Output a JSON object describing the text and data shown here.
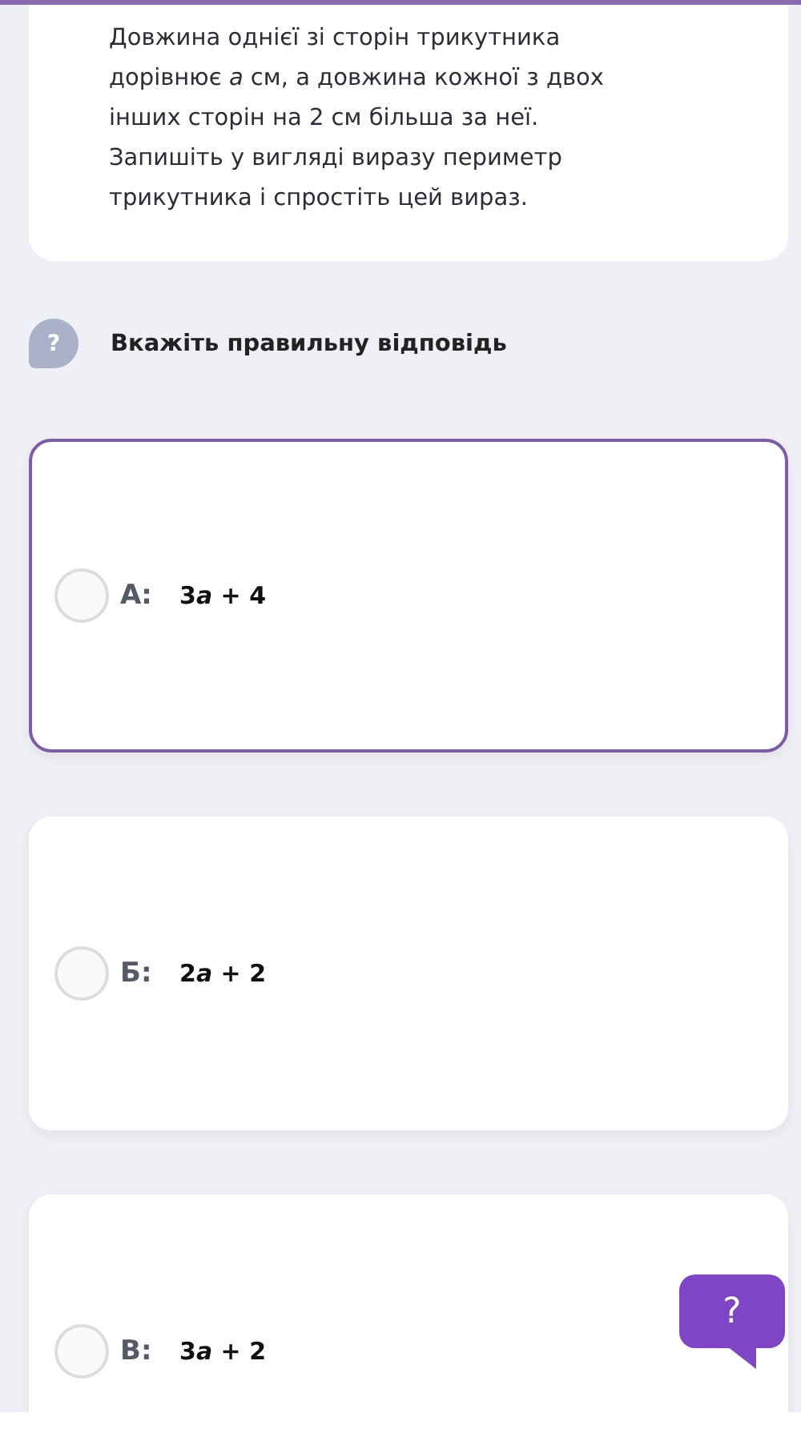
{
  "question": {
    "text": "Довжина однієї зі сторін трикутника дорівнює *a* см, а довжина кожної з двох інших сторін на 2 см більша за неї. Запишіть у вигляді виразу периметр трикутника і спростіть цей вираз."
  },
  "prompt": {
    "icon": "?",
    "text": "Вкажіть правильну відповідь"
  },
  "options": [
    {
      "letter": "А:",
      "answer": {
        "coefficient": "3",
        "variable": "a",
        "rest": " + 4"
      },
      "selected": true
    },
    {
      "letter": "Б:",
      "answer": {
        "coefficient": "2",
        "variable": "a",
        "rest": " + 2"
      },
      "selected": false
    },
    {
      "letter": "В:",
      "answer": {
        "coefficient": "3",
        "variable": "a",
        "rest": " + 2"
      },
      "selected": false
    }
  ],
  "help_button": {
    "label": "?"
  }
}
